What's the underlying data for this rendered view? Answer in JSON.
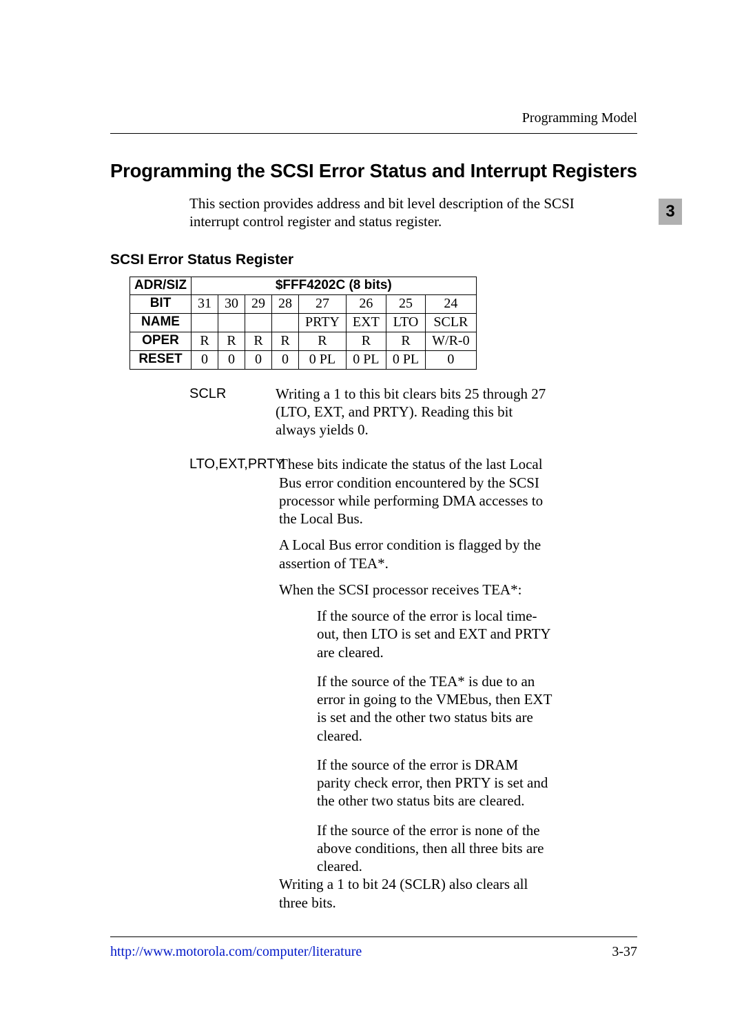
{
  "header": {
    "running_head": "Programming Model"
  },
  "side_tab": "3",
  "title": "Programming the SCSI Error Status and Interrupt Registers",
  "intro": "This section provides address and bit level description of the SCSI interrupt control register and status register.",
  "section_heading": "SCSI Error Status Register",
  "table": {
    "row_labels": [
      "ADR/SIZ",
      "BIT",
      "NAME",
      "OPER",
      "RESET"
    ],
    "address": "$FFF4202C (8 bits)",
    "bits": [
      "31",
      "30",
      "29",
      "28",
      "27",
      "26",
      "25",
      "24"
    ],
    "names": [
      "",
      "",
      "",
      "",
      "PRTY",
      "EXT",
      "LTO",
      "SCLR"
    ],
    "opers": [
      "R",
      "R",
      "R",
      "R",
      "R",
      "R",
      "R",
      "W/R-0"
    ],
    "resets": [
      "0",
      "0",
      "0",
      "0",
      "0 PL",
      "0 PL",
      "0 PL",
      "0"
    ]
  },
  "defs": [
    {
      "label": "SCLR",
      "paras": [
        "Writing a 1 to this bit clears bits 25 through 27 (LTO, EXT, and PRTY). Reading this bit always yields 0."
      ]
    },
    {
      "label": "LTO,EXT,PRTY",
      "paras": [
        "These bits indicate the status of the last Local Bus error condition encountered by the SCSI processor while performing DMA accesses to the Local Bus.",
        "A Local Bus error condition is flagged by the assertion of TEA*.",
        "When the SCSI processor receives TEA*:"
      ],
      "sublist": [
        "If the source of the error is local time-out, then LTO is set and EXT and PRTY are cleared.",
        "If the source of the TEA* is due to an error in going to the VMEbus, then EXT is set and the other two status bits are cleared.",
        "If the source of the error is DRAM parity check error, then PRTY is set and the other two status bits are cleared.",
        "If the source of the error is none of the above conditions, then all three bits are cleared."
      ],
      "trailer": "Writing a 1 to bit 24 (SCLR) also clears all three bits."
    }
  ],
  "footer": {
    "link_text": "http://www.motorola.com/computer/literature",
    "page_no": "3-37"
  }
}
